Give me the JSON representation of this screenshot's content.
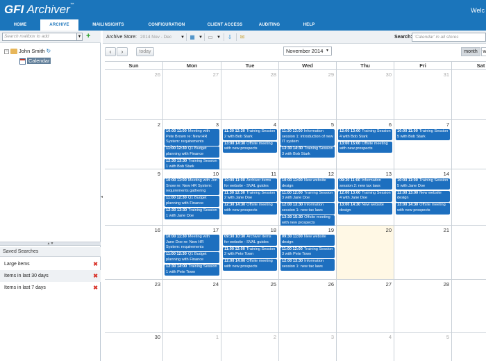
{
  "app": {
    "logo_brand": "GFI",
    "logo_product": "Archiver",
    "logo_tm": "™",
    "welcome": "Welc"
  },
  "nav": [
    {
      "label": "Home",
      "active": false
    },
    {
      "label": "Archive",
      "active": true
    },
    {
      "label": "MailInsights",
      "active": false
    },
    {
      "label": "Configuration",
      "active": false
    },
    {
      "label": "Client Access",
      "active": false
    },
    {
      "label": "Auditing",
      "active": false
    },
    {
      "label": "Help",
      "active": false
    }
  ],
  "sidebar": {
    "mailbox_placeholder": "Search mailbox to add",
    "tree": {
      "toggle": "−",
      "user": "John Smith",
      "refresh_icon": "↻",
      "calendar": "Calendar"
    },
    "saved_searches_title": "Saved Searches",
    "saved_searches": [
      {
        "label": "Large items"
      },
      {
        "label": "Items in last 30 days"
      },
      {
        "label": "Items in last 7 days"
      }
    ],
    "delete_icon": "✖"
  },
  "toolbar": {
    "archive_store_label": "Archive Store:",
    "archive_store_value": "2014 Nov - Dec",
    "search_label": "Search:",
    "search_placeholder": "'Calendar' in all stores"
  },
  "calendar_nav": {
    "prev": "‹",
    "next": "›",
    "today": "today",
    "month_label": "November 2014",
    "view_month": "month",
    "view_week": "w"
  },
  "weekdays": [
    "Sun",
    "Mon",
    "Tue",
    "Wed",
    "Thu",
    "Fri",
    "Sat"
  ],
  "weeks": [
    [
      {
        "day": "26",
        "other": true,
        "events": []
      },
      {
        "day": "27",
        "other": true,
        "events": []
      },
      {
        "day": "28",
        "other": true,
        "events": []
      },
      {
        "day": "29",
        "other": true,
        "events": []
      },
      {
        "day": "30",
        "other": true,
        "events": []
      },
      {
        "day": "31",
        "other": true,
        "events": []
      },
      {
        "day": "",
        "other": true,
        "events": []
      }
    ],
    [
      {
        "day": "2",
        "events": []
      },
      {
        "day": "3",
        "events": [
          {
            "time": "10:00 11:00",
            "title": "Meeting with Pete Brown re: New HR System: requirements gathering",
            "lines": 3
          },
          {
            "time": "11:00 12:30",
            "title": "Q1 Budget planning with Finance",
            "lines": 2
          },
          {
            "time": "12:30 13:30",
            "title": "Training Session 1 with Bob Stark",
            "lines": 2
          }
        ]
      },
      {
        "day": "4",
        "events": [
          {
            "time": "11:30 12:30",
            "title": "Training Session 2 with Bob Stark",
            "lines": 2
          },
          {
            "time": "13:00 14:30",
            "title": "Offsite meeting with new prospects",
            "lines": 2
          }
        ]
      },
      {
        "day": "5",
        "events": [
          {
            "time": "11:30 13:00",
            "title": "Information session 1: introduction of new IT system",
            "lines": 3
          },
          {
            "time": "13:30 14:30",
            "title": "Training Session 3 with Bob Stark",
            "lines": 2
          }
        ]
      },
      {
        "day": "6",
        "events": [
          {
            "time": "12:00 13:00",
            "title": "Training Session 4 with Bob Stark",
            "lines": 2
          },
          {
            "time": "13:00 15:00",
            "title": "Offsite meeting with new prospects",
            "lines": 2
          }
        ]
      },
      {
        "day": "7",
        "events": [
          {
            "time": "10:00 11:00",
            "title": "Training Session 5 with Bob Stark",
            "lines": 2
          }
        ]
      },
      {
        "day": "",
        "events": []
      }
    ],
    [
      {
        "day": "9",
        "events": []
      },
      {
        "day": "10",
        "events": [
          {
            "time": "10:00 11:00",
            "title": "Meeting with Jon Snow re: New HR System: requirements gathering",
            "lines": 3
          },
          {
            "time": "11:00 12:30",
            "title": "Q1 Budget planning with Finance",
            "lines": 2
          },
          {
            "time": "12:30 13:30",
            "title": "Training Session 1 with Jane Doe",
            "lines": 2
          }
        ]
      },
      {
        "day": "11",
        "events": [
          {
            "time": "10:00 11:00",
            "title": "Archiver items for website - SVAL guides next",
            "lines": 2
          },
          {
            "time": "11:30 12:30",
            "title": "Training Session 2 with Jane Doe",
            "lines": 2
          },
          {
            "time": "12:30 14:30",
            "title": "Offsite meeting with new prospects",
            "lines": 2
          }
        ]
      },
      {
        "day": "12",
        "events": [
          {
            "time": "10:00 11:00",
            "title": "New website design",
            "lines": 2
          },
          {
            "time": "11:00 12:00",
            "title": "Training Session 3 with Jane Doe",
            "lines": 2
          },
          {
            "time": "12:00 13:30",
            "title": "Information session 1: new tax laws",
            "lines": 2
          },
          {
            "time": "13:30 15:30",
            "title": "Offsite meeting with new prospects",
            "lines": 2
          }
        ]
      },
      {
        "day": "13",
        "events": [
          {
            "time": "09:30 11:00",
            "title": "Information session 2: new tax laws",
            "lines": 2
          },
          {
            "time": "12:00 13:00",
            "title": "Training Session 4 with Jane Doe",
            "lines": 2
          },
          {
            "time": "13:00 14:30",
            "title": "New website design",
            "lines": 2
          }
        ]
      },
      {
        "day": "14",
        "events": [
          {
            "time": "10:00 11:00",
            "title": "Training Session 5 with Jane Doe",
            "lines": 2
          },
          {
            "time": "12:00 13:00",
            "title": "New website design",
            "lines": 2
          },
          {
            "time": "13:00 14:30",
            "title": "Offsite meeting with new prospects",
            "lines": 2
          }
        ]
      },
      {
        "day": "",
        "events": []
      }
    ],
    [
      {
        "day": "16",
        "events": []
      },
      {
        "day": "17",
        "events": [
          {
            "time": "10:00 11:30",
            "title": "Meeting with Jane Doe re: New HR System: requirements gathering",
            "lines": 3
          },
          {
            "time": "11:00 12:30",
            "title": "Q1 Budget planning with Finance",
            "lines": 2
          },
          {
            "time": "12:30 14:00",
            "title": "Training Session 1 with Pete Town",
            "lines": 2
          }
        ]
      },
      {
        "day": "18",
        "events": [
          {
            "time": "09:30 10:30",
            "title": "Archiver items for website - SVAL guides next",
            "lines": 2
          },
          {
            "time": "11:00 12:00",
            "title": "Training Session 2 with Pete Town",
            "lines": 2
          },
          {
            "time": "12:00 14:00",
            "title": "Offsite meeting with new prospects",
            "lines": 2
          }
        ]
      },
      {
        "day": "19",
        "events": [
          {
            "time": "09:30 11:00",
            "title": "New website design",
            "lines": 2
          },
          {
            "time": "11:00 12:00",
            "title": "Training Session 3 with Pete Town",
            "lines": 2
          },
          {
            "time": "12:00 13:30",
            "title": "Information session 1: new tax laws",
            "lines": 2
          }
        ]
      },
      {
        "day": "20",
        "today": true,
        "events": []
      },
      {
        "day": "21",
        "events": []
      },
      {
        "day": "",
        "events": []
      }
    ],
    [
      {
        "day": "23",
        "events": []
      },
      {
        "day": "24",
        "events": []
      },
      {
        "day": "25",
        "events": []
      },
      {
        "day": "26",
        "events": []
      },
      {
        "day": "27",
        "events": []
      },
      {
        "day": "28",
        "events": []
      },
      {
        "day": "",
        "events": []
      }
    ],
    [
      {
        "day": "30",
        "events": []
      },
      {
        "day": "1",
        "other": true,
        "events": []
      },
      {
        "day": "2",
        "other": true,
        "events": []
      },
      {
        "day": "3",
        "other": true,
        "events": []
      },
      {
        "day": "4",
        "other": true,
        "events": []
      },
      {
        "day": "5",
        "other": true,
        "events": []
      },
      {
        "day": "",
        "other": true,
        "events": []
      }
    ]
  ]
}
